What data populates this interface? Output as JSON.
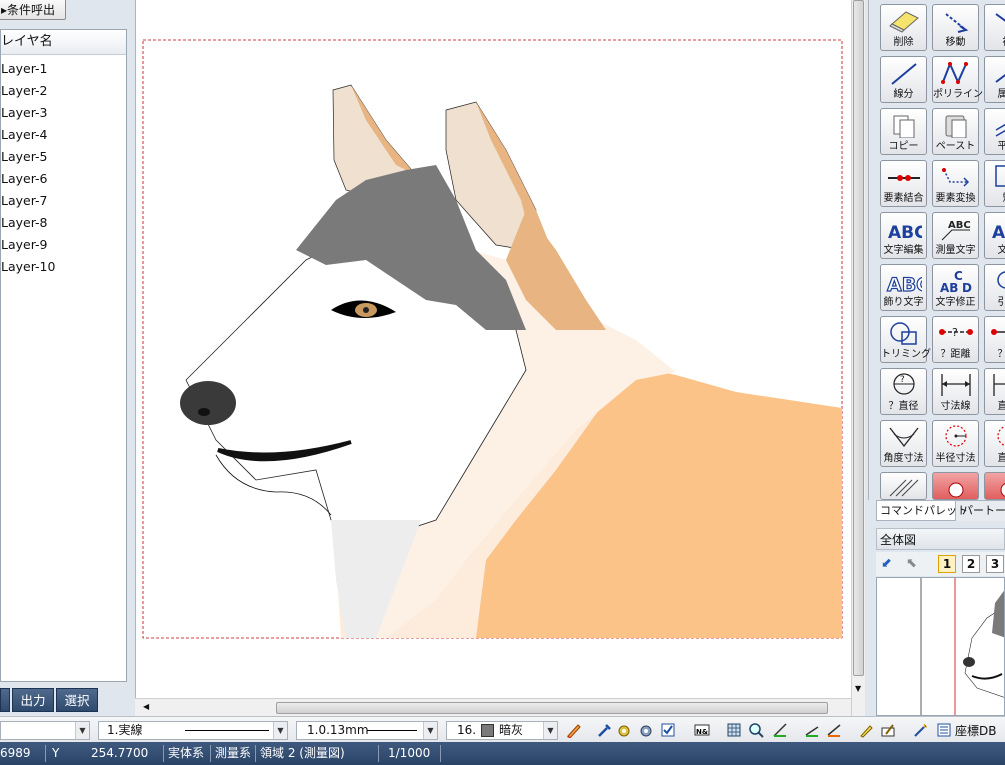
{
  "left_panel": {
    "condition_button": "条件呼出",
    "layer_header": "レイヤ名",
    "layers": [
      "Layer-1",
      "Layer-2",
      "Layer-3",
      "Layer-4",
      "Layer-5",
      "Layer-6",
      "Layer-7",
      "Layer-8",
      "Layer-9",
      "Layer-10"
    ],
    "tabs": [
      "出力",
      "選択"
    ]
  },
  "palette": {
    "commands": [
      {
        "label": "削除",
        "icon": "eraser-icon"
      },
      {
        "label": "移動",
        "icon": "move-icon"
      },
      {
        "label": "複",
        "icon": "copy-element-icon"
      },
      {
        "label": "線分",
        "icon": "line-segment-icon"
      },
      {
        "label": "ポリライン",
        "icon": "polyline-icon"
      },
      {
        "label": "属性",
        "icon": "attribute-icon"
      },
      {
        "label": "コピー",
        "icon": "copy-icon"
      },
      {
        "label": "ペースト",
        "icon": "paste-icon"
      },
      {
        "label": "平行",
        "icon": "parallel-icon"
      },
      {
        "label": "要素結合",
        "icon": "join-icon"
      },
      {
        "label": "要素変換",
        "icon": "convert-icon"
      },
      {
        "label": "矩",
        "icon": "rectangle-icon"
      },
      {
        "label": "文字編集",
        "icon": "text-edit-icon"
      },
      {
        "label": "測量文字",
        "icon": "survey-text-icon"
      },
      {
        "label": "文字",
        "icon": "text-icon"
      },
      {
        "label": "飾り文字",
        "icon": "decorated-text-icon"
      },
      {
        "label": "文字修正",
        "icon": "text-fix-icon"
      },
      {
        "label": "引出",
        "icon": "leader-icon"
      },
      {
        "label": "トリミング",
        "icon": "trim-icon"
      },
      {
        "label": "？距離",
        "icon": "distance-icon"
      },
      {
        "label": "？角",
        "icon": "angle-query-icon"
      },
      {
        "label": "？直径",
        "icon": "diameter-query-icon"
      },
      {
        "label": "寸法線",
        "icon": "dimension-icon"
      },
      {
        "label": "直列",
        "icon": "serial-dimension-icon"
      },
      {
        "label": "角度寸法",
        "icon": "angle-dimension-icon"
      },
      {
        "label": "半径寸法",
        "icon": "radius-dimension-icon"
      },
      {
        "label": "直径",
        "icon": "diameter-dimension-icon"
      }
    ],
    "tabs": [
      "コマンドパレット",
      "パートー"
    ]
  },
  "overview": {
    "title": "全体図",
    "pages": [
      "1",
      "2",
      "3"
    ]
  },
  "toolbar": {
    "line_type": "1.実線",
    "line_width": "1.0.13mm",
    "color_label": "16.",
    "color_name": "暗灰",
    "color_swatch": "#7a7a7a",
    "coord_db": "座標DB"
  },
  "status": {
    "x_value": "6989",
    "y_label": "Y",
    "y_value": "254.7700",
    "system": "実体系",
    "survey": "測量系",
    "region": "領域 2 (測量図)",
    "scale": "1/1000"
  }
}
